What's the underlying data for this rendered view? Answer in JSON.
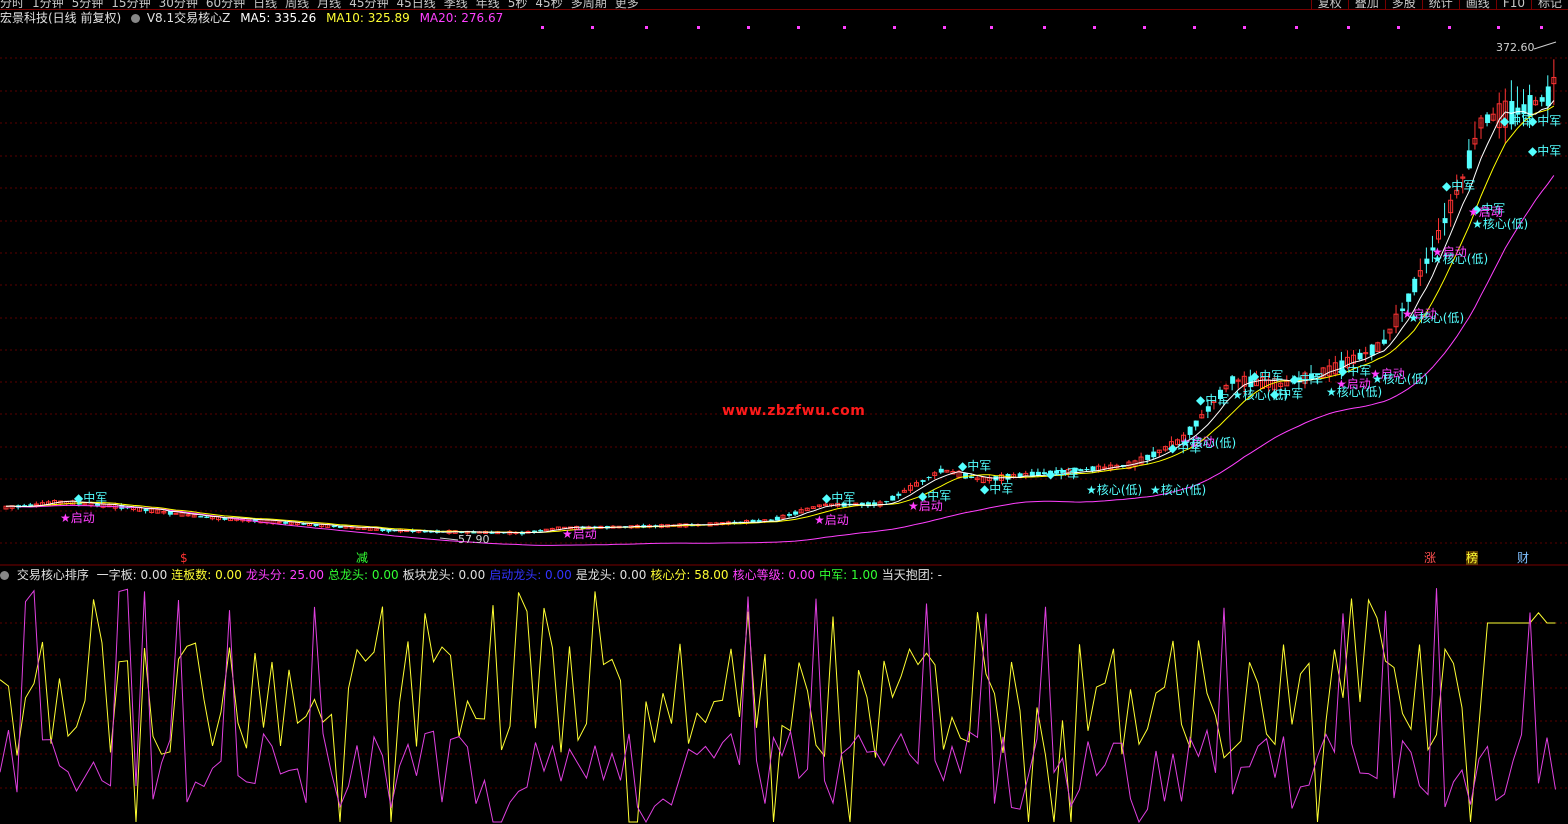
{
  "topbar": {
    "periods": [
      "分时",
      "1分钟",
      "5分钟",
      "15分钟",
      "30分钟",
      "60分钟",
      "日线",
      "周线",
      "月线",
      "45分钟",
      "45日线",
      "季线",
      "年线",
      "5秒",
      "45秒",
      "多周期",
      "更多"
    ],
    "buttons": [
      "复权",
      "叠加",
      "多股",
      "统计",
      "画线",
      "F10",
      "标记"
    ]
  },
  "info": {
    "stock_name": "宏景科技(日线 前复权)",
    "indicator": "V8.1交易核心Z",
    "ma5_label": "MA5: 335.26",
    "ma10_label": "MA10: 325.89",
    "ma20_label": "MA20: 276.67"
  },
  "colors": {
    "up": "#ff3333",
    "down": "#54ffff",
    "ma5": "#ffffff",
    "ma10": "#ffff00",
    "ma20": "#ff40ff",
    "grid": "#5a0000",
    "osc_yellow": "#ffff33",
    "osc_magenta": "#e040e0"
  },
  "price_labels": {
    "high": "372.60",
    "low": "57.90"
  },
  "watermark": "www.zbzfwu.com",
  "markers": {
    "left": "$",
    "mid": "减",
    "r1": "涨",
    "r2": "榜",
    "r3": "财"
  },
  "signals": {
    "zhongjun": "中军",
    "qidong": "★启动",
    "hexin": "★核心(低)"
  },
  "indicator_bar": {
    "name": "交易核心排序",
    "items": [
      {
        "text": "一字板: 0.00",
        "color": "#e0e0e0"
      },
      {
        "text": "连板数: 0.00",
        "color": "#ffff33"
      },
      {
        "text": "龙头分: 25.00",
        "color": "#ff40ff"
      },
      {
        "text": "总龙头: 0.00",
        "color": "#33ff33"
      },
      {
        "text": "板块龙头: 0.00",
        "color": "#e0e0e0"
      },
      {
        "text": "启动龙头: 0.00",
        "color": "#3333ff"
      },
      {
        "text": "是龙头: 0.00",
        "color": "#e0e0e0"
      },
      {
        "text": "核心分: 58.00",
        "color": "#ffff33"
      },
      {
        "text": "核心等级: 0.00",
        "color": "#ff40ff"
      },
      {
        "text": "中军: 1.00",
        "color": "#33ff33"
      },
      {
        "text": "当天抱团: -",
        "color": "#e0e0e0"
      }
    ]
  },
  "chart_data": {
    "type": "line",
    "series": [
      {
        "name": "MA5",
        "values": [
          335.26
        ]
      },
      {
        "name": "MA10",
        "values": [
          325.89
        ]
      },
      {
        "name": "MA20",
        "values": [
          276.67
        ]
      }
    ],
    "annotations": [
      "372.60",
      "57.90"
    ]
  }
}
